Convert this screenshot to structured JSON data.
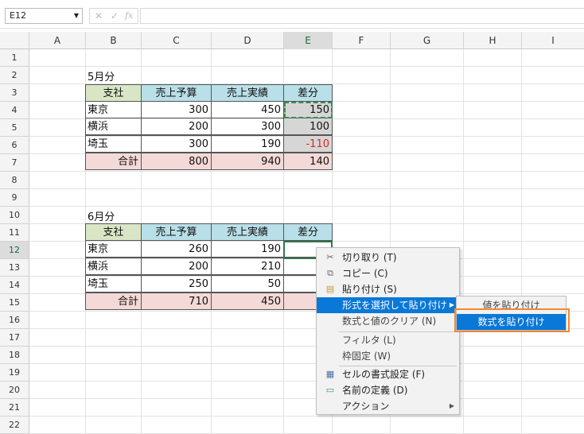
{
  "formula_bar": {
    "name_box": "E12",
    "cancel_icon": "✕",
    "enter_icon": "✓",
    "fx_label": "fx"
  },
  "columns": [
    "A",
    "B",
    "C",
    "D",
    "E",
    "F",
    "G",
    "H",
    "I"
  ],
  "rows": [
    "1",
    "2",
    "3",
    "4",
    "5",
    "6",
    "7",
    "8",
    "9",
    "10",
    "11",
    "12",
    "13",
    "14",
    "15",
    "16",
    "17",
    "18",
    "19",
    "20",
    "21",
    "22"
  ],
  "table1": {
    "caption": "5月分",
    "headers": [
      "支社",
      "売上予算",
      "売上実績",
      "差分"
    ],
    "rows": [
      {
        "branch": "東京",
        "budget": "300",
        "actual": "450",
        "diff": "150"
      },
      {
        "branch": "横浜",
        "budget": "200",
        "actual": "300",
        "diff": "100"
      },
      {
        "branch": "埼玉",
        "budget": "300",
        "actual": "190",
        "diff": "-110"
      }
    ],
    "total": {
      "label": "合計",
      "budget": "800",
      "actual": "940",
      "diff": "140"
    }
  },
  "table2": {
    "caption": "6月分",
    "headers": [
      "支社",
      "売上予算",
      "売上実績",
      "差分"
    ],
    "rows": [
      {
        "branch": "東京",
        "budget": "260",
        "actual": "190"
      },
      {
        "branch": "横浜",
        "budget": "200",
        "actual": "210"
      },
      {
        "branch": "埼玉",
        "budget": "250",
        "actual": "50"
      }
    ],
    "total": {
      "label": "合計",
      "budget": "710",
      "actual": "450"
    }
  },
  "context_menu": {
    "items": [
      {
        "label": "切り取り (T)",
        "icon": "scissors-icon",
        "glyph": "✂"
      },
      {
        "label": "コピー (C)",
        "icon": "copy-icon",
        "glyph": "⧉"
      },
      {
        "label": "貼り付け (S)",
        "icon": "paste-icon",
        "glyph": "▤"
      },
      {
        "label": "形式を選択して貼り付け",
        "icon": "",
        "glyph": ""
      },
      {
        "label": "数式と値のクリア (N)",
        "icon": "",
        "glyph": ""
      },
      {
        "label": "フィルタ (L)",
        "icon": "",
        "glyph": ""
      },
      {
        "label": "枠固定 (W)",
        "icon": "",
        "glyph": ""
      },
      {
        "label": "セルの書式設定 (F)",
        "icon": "format-cells-icon",
        "glyph": "▦"
      },
      {
        "label": "名前の定義 (D)",
        "icon": "name-tag-icon",
        "glyph": "▭"
      },
      {
        "label": "アクション",
        "icon": "",
        "glyph": ""
      }
    ]
  },
  "submenu": {
    "items": [
      "値を貼り付け",
      "数式を貼り付け"
    ]
  },
  "colors": {
    "highlight": "#0a78d7",
    "callout": "#f08a32",
    "negative": "#e0251b"
  }
}
